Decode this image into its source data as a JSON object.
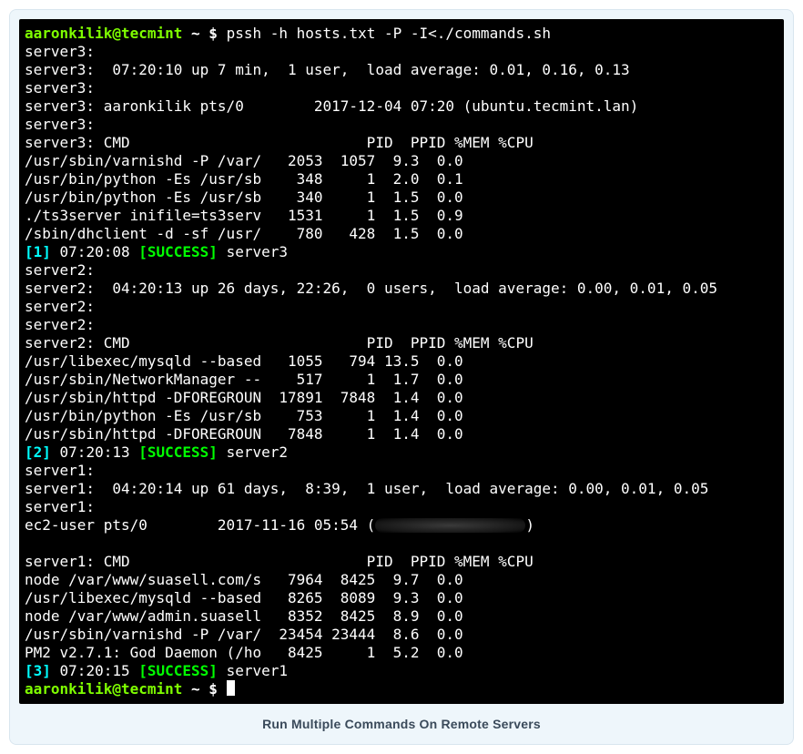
{
  "caption": "Run Multiple Commands On Remote Servers",
  "prompt1": {
    "user": "aaronkilik@tecmint",
    "path": "~ $",
    "command": "pssh -h hosts.txt -P -I<./commands.sh"
  },
  "s3": {
    "h0": "server3:",
    "uptime": "server3:  07:20:10 up 7 min,  1 user,  load average: 0.01, 0.16, 0.13",
    "h1": "server3:",
    "who": "server3: aaronkilik pts/0        2017-12-04 07:20 (ubuntu.tecmint.lan)",
    "h2": "server3:",
    "header": "server3: CMD                           PID  PPID %MEM %CPU",
    "r0": "/usr/sbin/varnishd -P /var/   2053  1057  9.3  0.0",
    "r1": "/usr/bin/python -Es /usr/sb    348     1  2.0  0.1",
    "r2": "/usr/bin/python -Es /usr/sb    340     1  1.5  0.0",
    "r3": "./ts3server inifile=ts3serv   1531     1  1.5  0.9",
    "r4": "/sbin/dhclient -d -sf /usr/    780   428  1.5  0.0",
    "res_idx": "[1]",
    "res_time": " 07:20:08 ",
    "res_status": "[SUCCESS]",
    "res_host": " server3"
  },
  "s2": {
    "h0": "server2:",
    "uptime": "server2:  04:20:13 up 26 days, 22:26,  0 users,  load average: 0.00, 0.01, 0.05",
    "h1": "server2:",
    "h2": "server2:",
    "header": "server2: CMD                           PID  PPID %MEM %CPU",
    "r0": "/usr/libexec/mysqld --based   1055   794 13.5  0.0",
    "r1": "/usr/sbin/NetworkManager --    517     1  1.7  0.0",
    "r2": "/usr/sbin/httpd -DFOREGROUN  17891  7848  1.4  0.0",
    "r3": "/usr/bin/python -Es /usr/sb    753     1  1.4  0.0",
    "r4": "/usr/sbin/httpd -DFOREGROUN   7848     1  1.4  0.0",
    "res_idx": "[2]",
    "res_time": " 07:20:13 ",
    "res_status": "[SUCCESS]",
    "res_host": " server2"
  },
  "s1": {
    "h0": "server1:",
    "uptime": "server1:  04:20:14 up 61 days,  8:39,  1 user,  load average: 0.00, 0.01, 0.05",
    "h1": "server1:",
    "who_pre": "ec2-user pts/0        2017-11-16 05:54 (",
    "who_post": ")",
    "blank": " ",
    "header": "server1: CMD                           PID  PPID %MEM %CPU",
    "r0": "node /var/www/suasell.com/s   7964  8425  9.7  0.0",
    "r1": "/usr/libexec/mysqld --based   8265  8089  9.3  0.0",
    "r2": "node /var/www/admin.suasell   8352  8425  8.9  0.0",
    "r3": "/usr/sbin/varnishd -P /var/  23454 23444  8.6  0.0",
    "r4": "PM2 v2.7.1: God Daemon (/ho   8425     1  5.2  0.0",
    "res_idx": "[3]",
    "res_time": " 07:20:15 ",
    "res_status": "[SUCCESS]",
    "res_host": " server1"
  },
  "prompt2": {
    "user": "aaronkilik@tecmint",
    "path": "~ $"
  }
}
